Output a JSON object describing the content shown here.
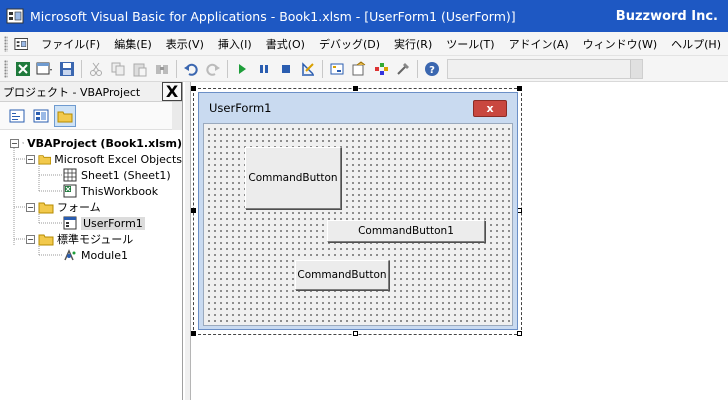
{
  "window": {
    "title": "Microsoft Visual Basic for Applications - Book1.xlsm - [UserForm1 (UserForm)]",
    "brand": "Buzzword Inc."
  },
  "menubar": {
    "items": [
      "ファイル(F)",
      "編集(E)",
      "表示(V)",
      "挿入(I)",
      "書式(O)",
      "デバッグ(D)",
      "実行(R)",
      "ツール(T)",
      "アドイン(A)",
      "ウィンドウ(W)",
      "ヘルプ(H)"
    ]
  },
  "toolbar": {
    "icons": [
      "excel-icon",
      "insert-userform-icon",
      "save-icon",
      "cut-icon",
      "copy-icon",
      "paste-icon",
      "find-icon",
      "undo-icon",
      "redo-icon",
      "run-icon",
      "pause-icon",
      "reset-icon",
      "design-mode-icon",
      "project-explorer-icon",
      "properties-icon",
      "object-browser-icon",
      "toolbox-icon",
      "help-icon"
    ]
  },
  "project_pane": {
    "title": "プロジェクト - VBAProject",
    "close_label": "X",
    "tree": [
      {
        "label": "VBAProject (Book1.xlsm)",
        "level": 0,
        "bold": true,
        "icon": "vba-project-icon",
        "toggle": "−"
      },
      {
        "label": "Microsoft Excel Objects",
        "level": 1,
        "icon": "folder-icon",
        "toggle": "−"
      },
      {
        "label": "Sheet1 (Sheet1)",
        "level": 2,
        "icon": "sheet-icon"
      },
      {
        "label": "ThisWorkbook",
        "level": 2,
        "icon": "workbook-icon"
      },
      {
        "label": "フォーム",
        "level": 1,
        "icon": "folder-icon",
        "toggle": "−"
      },
      {
        "label": "UserForm1",
        "level": 2,
        "icon": "userform-icon",
        "selected": true
      },
      {
        "label": "標準モジュール",
        "level": 1,
        "icon": "folder-icon",
        "toggle": "−"
      },
      {
        "label": "Module1",
        "level": 2,
        "icon": "module-icon"
      }
    ]
  },
  "userform": {
    "title": "UserForm1",
    "close_label": "x",
    "buttons": [
      {
        "caption": "CommandButton"
      },
      {
        "caption": "CommandButton1"
      },
      {
        "caption": "CommandButton"
      }
    ]
  }
}
